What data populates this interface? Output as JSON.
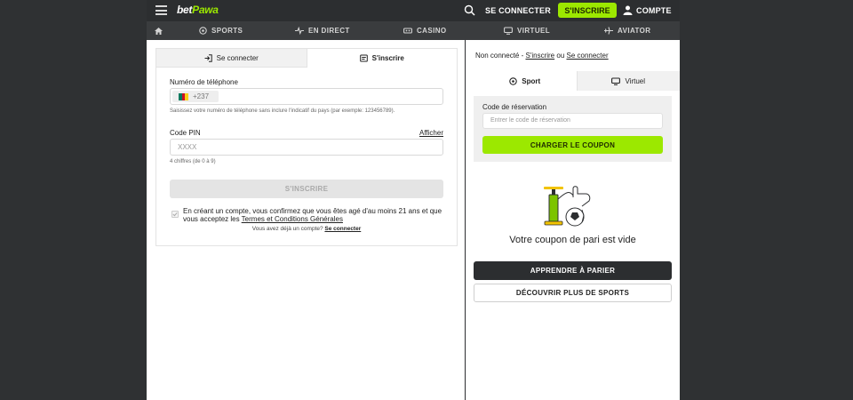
{
  "brand": {
    "logo_main": "bet",
    "logo_accent": "Pawa",
    "accent_color": "#9ce800"
  },
  "header": {
    "login_label": "SE CONNECTER",
    "register_label": "S'INSCRIRE",
    "account_label": "COMPTE",
    "icons": [
      "menu-icon",
      "search-icon",
      "user-icon"
    ]
  },
  "nav": {
    "items": [
      {
        "label": "",
        "icon": "home-icon"
      },
      {
        "label": "SPORTS",
        "icon": "soccer-ball-icon"
      },
      {
        "label": "EN DIRECT",
        "icon": "live-icon"
      },
      {
        "label": "CASINO",
        "icon": "casino-icon"
      },
      {
        "label": "VIRTUEL",
        "icon": "virtual-icon"
      },
      {
        "label": "AVIATOR",
        "icon": "plane-icon"
      }
    ]
  },
  "auth": {
    "tabs": [
      {
        "label": "Se connecter",
        "icon": "login-icon",
        "active": false
      },
      {
        "label": "S'inscrire",
        "icon": "register-icon",
        "active": true
      }
    ],
    "phone_label": "Numéro de téléphone",
    "phone_prefix": "+237",
    "phone_value": "",
    "phone_hint": "Saisissez votre numéro de téléphone sans inclure l'indicatif du pays (par exemple: 123456789).",
    "pin_label": "Code PIN",
    "show_label": "Afficher",
    "pin_placeholder": "XXXX",
    "pin_hint": "4 chiffres (de 0 à 9)",
    "submit_label": "S'INSCRIRE",
    "consent_pre": "En créant un compte, vous confirmez que vous êtes agé d'au moins 21 ans et que vous acceptez les ",
    "consent_link": "Termes et Conditions Générales",
    "already_text": "Vous avez déjà un compte? ",
    "already_link": "Se connecter"
  },
  "betslip": {
    "status_prefix": "Non connecté - ",
    "status_register": "S'inscrire",
    "status_or": " ou ",
    "status_login": "Se connecter",
    "tabs": [
      {
        "label": "Sport",
        "icon": "soccer-ball-icon",
        "active": true
      },
      {
        "label": "Virtuel",
        "icon": "virtual-icon",
        "active": false
      }
    ],
    "booking_label": "Code de réservation",
    "booking_placeholder": "Entrer le code de réservation",
    "load_label": "CHARGER LE COUPON",
    "empty_text": "Votre coupon de pari est vide",
    "learn_label": "APPRENDRE À PARIER",
    "discover_label": "DÉCOUVRIR PLUS DE SPORTS"
  }
}
